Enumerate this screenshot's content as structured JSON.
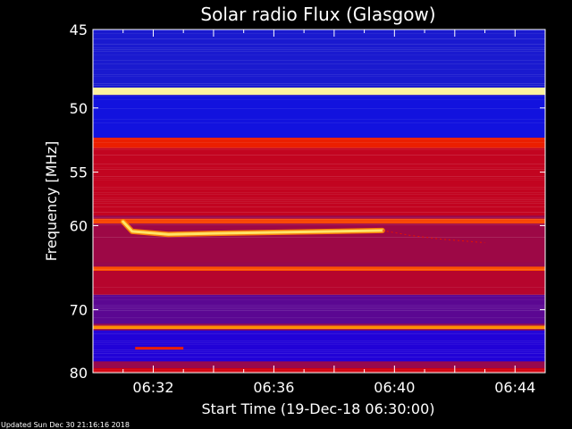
{
  "chart_data": {
    "type": "heatmap",
    "title": "Solar radio Flux (Glasgow)",
    "xlabel": "Start Time (19-Dec-18 06:30:00)",
    "ylabel": "Frequency [MHz]",
    "x_range_minutes": [
      0,
      15.0
    ],
    "x_ticks": [
      {
        "minute": 2,
        "label": "06:32"
      },
      {
        "minute": 6,
        "label": "06:36"
      },
      {
        "minute": 10,
        "label": "06:40"
      },
      {
        "minute": 14,
        "label": "06:44"
      }
    ],
    "y_scale": "reciprocal",
    "y_range_mhz": [
      45,
      80
    ],
    "y_ticks": [
      45,
      50,
      55,
      60,
      70,
      80
    ],
    "colormap": [
      "#000064",
      "#1e1ec8",
      "#0000ff",
      "#8a0a5a",
      "#e10000",
      "#ff5a00",
      "#ffc800",
      "#ffffc8"
    ],
    "background_level": 0.45,
    "frequency_bands": [
      {
        "from_mhz": 45,
        "to_mhz": 48.6,
        "level": 0.16
      },
      {
        "from_mhz": 48.6,
        "to_mhz": 49.1,
        "level": 0.97
      },
      {
        "from_mhz": 49.1,
        "to_mhz": 52.2,
        "level": 0.2
      },
      {
        "from_mhz": 52.2,
        "to_mhz": 53.0,
        "level": 0.62
      },
      {
        "from_mhz": 53.0,
        "to_mhz": 59.0,
        "level": 0.52
      },
      {
        "from_mhz": 59.3,
        "to_mhz": 59.8,
        "level": 0.68
      },
      {
        "from_mhz": 59.8,
        "to_mhz": 64.0,
        "level": 0.46
      },
      {
        "from_mhz": 64.5,
        "to_mhz": 65.0,
        "level": 0.7
      },
      {
        "from_mhz": 65.0,
        "to_mhz": 68.0,
        "level": 0.5
      },
      {
        "from_mhz": 68.0,
        "to_mhz": 72.0,
        "level": 0.38
      },
      {
        "from_mhz": 72.3,
        "to_mhz": 72.8,
        "level": 0.78
      },
      {
        "from_mhz": 73.0,
        "to_mhz": 78.0,
        "level": 0.32
      },
      {
        "from_mhz": 79.2,
        "to_mhz": 80.0,
        "level": 0.55
      }
    ],
    "burst": {
      "points": [
        {
          "minute": 1.0,
          "mhz": 59.6
        },
        {
          "minute": 1.3,
          "mhz": 60.6
        },
        {
          "minute": 2.5,
          "mhz": 60.9
        },
        {
          "minute": 4.0,
          "mhz": 60.8
        },
        {
          "minute": 6.0,
          "mhz": 60.7
        },
        {
          "minute": 8.0,
          "mhz": 60.6
        },
        {
          "minute": 9.6,
          "mhz": 60.5
        }
      ],
      "tail": [
        {
          "minute": 9.6,
          "mhz": 60.5
        },
        {
          "minute": 10.5,
          "mhz": 61.0
        },
        {
          "minute": 11.5,
          "mhz": 61.4
        },
        {
          "minute": 13.0,
          "mhz": 61.8
        }
      ],
      "level": 0.93
    },
    "streak": {
      "from_minute": 1.4,
      "to_minute": 3.0,
      "mhz": 75.8,
      "level": 0.62
    }
  },
  "footer": {
    "updated": "Updated Sun Dec 30 21:16:16 2018"
  }
}
